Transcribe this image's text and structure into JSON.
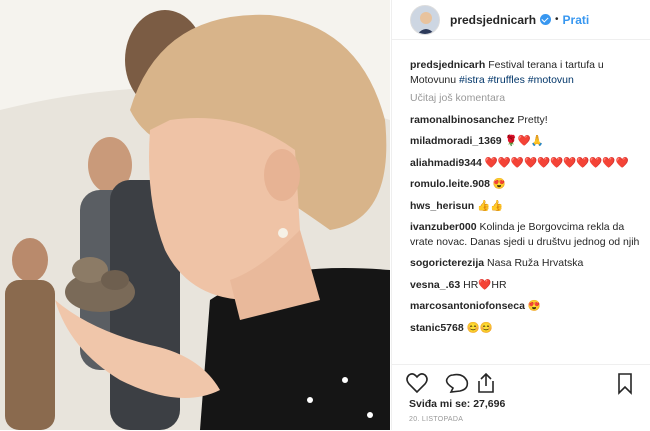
{
  "post": {
    "username": "predsjednicarh",
    "follow_label": "Prati",
    "dot": "•",
    "caption_user": "predsjednicarh",
    "caption_text": "Festival terana i tartufa u Motovunu",
    "hashtags": [
      "#istra",
      "#truffles",
      "#motovun"
    ],
    "load_more": "Učitaj još komentara"
  },
  "comments": [
    {
      "user": "ramonalbinosanchez",
      "text": "Pretty!"
    },
    {
      "user": "miladmoradi_1369",
      "text": "🌹❤️🙏"
    },
    {
      "user": "aliahmadi9344",
      "text": "❤️❤️❤️❤️❤️❤️❤️❤️❤️❤️❤️"
    },
    {
      "user": "romulo.leite.908",
      "text": "😍"
    },
    {
      "user": "hws_herisun",
      "text": "👍👍"
    },
    {
      "user": "ivanzuber000",
      "text": "Kolinda je Borgovcima rekla da vrate novac. Danas sjedi u društvu jednog od njih"
    },
    {
      "user": "sogoricterezija",
      "text": "Nasa Ruža Hrvatska"
    },
    {
      "user": "vesna_.63",
      "text": "HR❤️HR"
    },
    {
      "user": "marcosantoniofonseca",
      "text": "😍"
    },
    {
      "user": "stanic5768",
      "text": "😊😊"
    }
  ],
  "footer": {
    "likes": "Sviđa mi se: 27,696",
    "date": "20. LISTOPADA"
  },
  "icons": [
    "heart-icon",
    "comment-icon",
    "share-icon",
    "bookmark-icon"
  ]
}
